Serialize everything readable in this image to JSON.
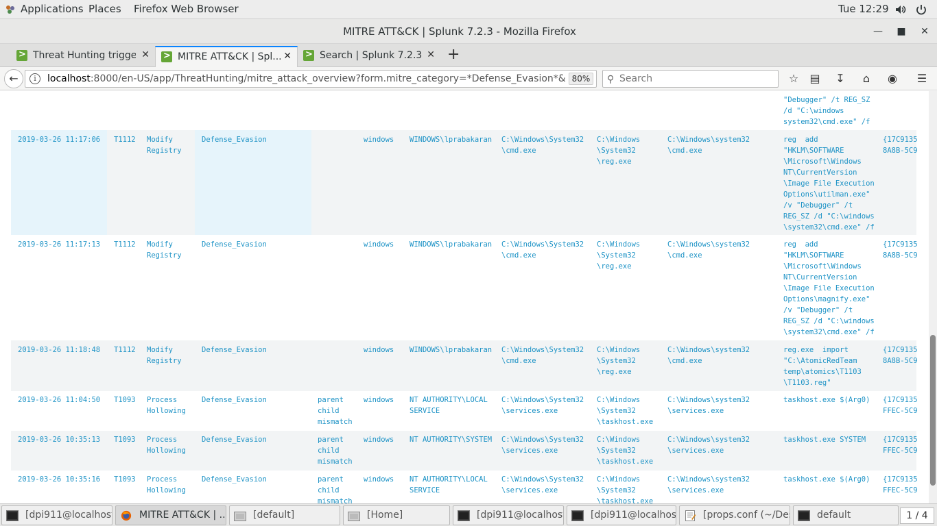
{
  "topbar": {
    "applications": "Applications",
    "places": "Places",
    "active_app": "Firefox Web Browser",
    "clock": "Tue 12:29"
  },
  "window": {
    "title": "MITRE ATT&CK | Splunk 7.2.3 - Mozilla Firefox"
  },
  "tabs": [
    {
      "label": "Threat Hunting trigge..."
    },
    {
      "label": "MITRE ATT&CK | Spl..."
    },
    {
      "label": "Search | Splunk 7.2.3"
    }
  ],
  "navbar": {
    "url_host": "localhost",
    "url_path": ":8000/en-US/app/ThreatHunting/mitre_attack_overview?form.mitre_category=*Defense_Evasion*&",
    "zoom": "80%",
    "search_placeholder": "Search"
  },
  "top_partial": {
    "command": "\"Debugger\" /t REG_SZ\n/d \"C:\\windows\nsystem32\\cmd.exe\" /f"
  },
  "rows": [
    {
      "time": "2019-03-26 11:17:06",
      "technique_id": "T1112",
      "technique": "Modify\nRegistry",
      "category": "Defense_Evasion",
      "note": "",
      "os": "windows",
      "user": "WINDOWS\\lprabakaran",
      "parent_image": "C:\\Windows\\System32\n\\cmd.exe",
      "image": "C:\\Windows\n\\System32\n\\reg.exe",
      "parent_path": "C:\\Windows\\system32\n\\cmd.exe",
      "command": "reg  add\n\"HKLM\\SOFTWARE\n\\Microsoft\\Windows\nNT\\CurrentVersion\n\\Image File Execution\nOptions\\utilman.exe\"\n/v \"Debugger\" /t\nREG_SZ /d \"C:\\windows\n\\system32\\cmd.exe\" /f",
      "guid": "{17C9135\n8A8B-5C9"
    },
    {
      "time": "2019-03-26 11:17:13",
      "technique_id": "T1112",
      "technique": "Modify\nRegistry",
      "category": "Defense_Evasion",
      "note": "",
      "os": "windows",
      "user": "WINDOWS\\lprabakaran",
      "parent_image": "C:\\Windows\\System32\n\\cmd.exe",
      "image": "C:\\Windows\n\\System32\n\\reg.exe",
      "parent_path": "C:\\Windows\\system32\n\\cmd.exe",
      "command": "reg  add\n\"HKLM\\SOFTWARE\n\\Microsoft\\Windows\nNT\\CurrentVersion\n\\Image File Execution\nOptions\\magnify.exe\"\n/v \"Debugger\" /t\nREG_SZ /d \"C:\\windows\n\\system32\\cmd.exe\" /f",
      "guid": "{17C9135\n8A8B-5C9"
    },
    {
      "time": "2019-03-26 11:18:48",
      "technique_id": "T1112",
      "technique": "Modify\nRegistry",
      "category": "Defense_Evasion",
      "note": "",
      "os": "windows",
      "user": "WINDOWS\\lprabakaran",
      "parent_image": "C:\\Windows\\System32\n\\cmd.exe",
      "image": "C:\\Windows\n\\System32\n\\reg.exe",
      "parent_path": "C:\\Windows\\system32\n\\cmd.exe",
      "command": "reg.exe  import\n\"C:\\AtomicRedTeam\ntemp\\atomics\\T1103\n\\T1103.reg\"",
      "guid": "{17C9135\n8A8B-5C9"
    },
    {
      "time": "2019-03-26 11:04:50",
      "technique_id": "T1093",
      "technique": "Process\nHollowing",
      "category": "Defense_Evasion",
      "note": "parent\nchild\nmismatch",
      "os": "windows",
      "user": "NT AUTHORITY\\LOCAL\nSERVICE",
      "parent_image": "C:\\Windows\\System32\n\\services.exe",
      "image": "C:\\Windows\n\\System32\n\\taskhost.exe",
      "parent_path": "C:\\Windows\\system32\n\\services.exe",
      "command": "taskhost.exe $(Arg0)",
      "guid": "{17C9135\nFFEC-5C9"
    },
    {
      "time": "2019-03-26 10:35:13",
      "technique_id": "T1093",
      "technique": "Process\nHollowing",
      "category": "Defense_Evasion",
      "note": "parent\nchild\nmismatch",
      "os": "windows",
      "user": "NT AUTHORITY\\SYSTEM",
      "parent_image": "C:\\Windows\\System32\n\\services.exe",
      "image": "C:\\Windows\n\\System32\n\\taskhost.exe",
      "parent_path": "C:\\Windows\\system32\n\\services.exe",
      "command": "taskhost.exe SYSTEM",
      "guid": "{17C9135\nFFEC-5C9"
    },
    {
      "time": "2019-03-26 10:35:16",
      "technique_id": "T1093",
      "technique": "Process\nHollowing",
      "category": "Defense_Evasion",
      "note": "parent\nchild\nmismatch",
      "os": "windows",
      "user": "NT AUTHORITY\\LOCAL\nSERVICE",
      "parent_image": "C:\\Windows\\System32\n\\services.exe",
      "image": "C:\\Windows\n\\System32\n\\taskhost.exe",
      "parent_path": "C:\\Windows\\system32\n\\services.exe",
      "command": "taskhost.exe $(Arg0)",
      "guid": "{17C9135\nFFEC-5C9"
    }
  ],
  "taskbar": {
    "items": [
      {
        "label": "[dpi911@localhost..."
      },
      {
        "label": "MITRE ATT&CK | ..."
      },
      {
        "label": "[default]"
      },
      {
        "label": "[Home]"
      },
      {
        "label": "[dpi911@localhost..."
      },
      {
        "label": "[dpi911@localhost..."
      },
      {
        "label": "[props.conf (~/Des..."
      },
      {
        "label": "default"
      }
    ],
    "pager": "1 / 4"
  }
}
